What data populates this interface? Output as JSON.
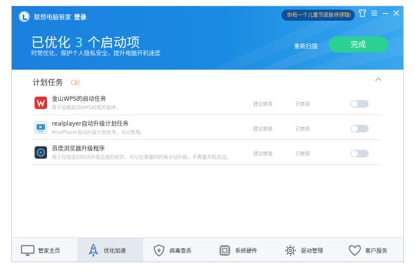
{
  "app": {
    "title": "联想电脑管家",
    "login_label": "登录"
  },
  "promo": {
    "text": "你有一个儿童节皮肤待领取"
  },
  "header": {
    "headline_prefix": "已优化",
    "headline_count": "3",
    "headline_suffix": "个启动项",
    "subline": "时常优化，保护个人隐私安全，提升电脑开机速度",
    "rescan_label": "重新扫描",
    "done_label": "完成"
  },
  "section": {
    "title": "计划任务",
    "count": "（3）"
  },
  "tasks": [
    {
      "name": "金山WPS的启动任务",
      "desc": "用于定期启动WPS的相关程序。",
      "advice": "建议禁用",
      "status": "已禁用",
      "icon": "wps-icon",
      "enabled": false
    },
    {
      "name": "realplayer自动升级计划任务",
      "desc": "RealPlayer自动升级计划任务，可以禁用。",
      "advice": "建议禁用",
      "status": "已禁用",
      "icon": "realplayer-icon",
      "enabled": false
    },
    {
      "name": "百度浏览器升级程序",
      "desc": "用于在指定的时间升级百度的软件，可以在需要的时候手动升级，不需要开机启动。",
      "advice": "建议禁用",
      "status": "已禁用",
      "icon": "baidu-browser-icon",
      "enabled": false
    }
  ],
  "nav": [
    {
      "label": "管家主页",
      "icon": "monitor-icon",
      "active": false
    },
    {
      "label": "优化加速",
      "icon": "rocket-icon",
      "active": true
    },
    {
      "label": "病毒查杀",
      "icon": "shield-icon",
      "active": false
    },
    {
      "label": "系统硬件",
      "icon": "chip-icon",
      "active": false
    },
    {
      "label": "驱动管理",
      "icon": "gear-icon",
      "active": false
    },
    {
      "label": "客户服务",
      "icon": "heart-icon",
      "active": false
    }
  ],
  "colors": {
    "header": "#1b80de",
    "accent_green": "#2ad193",
    "count_orange": "#e08a3a",
    "promo_bg": "#0e4f9c"
  }
}
